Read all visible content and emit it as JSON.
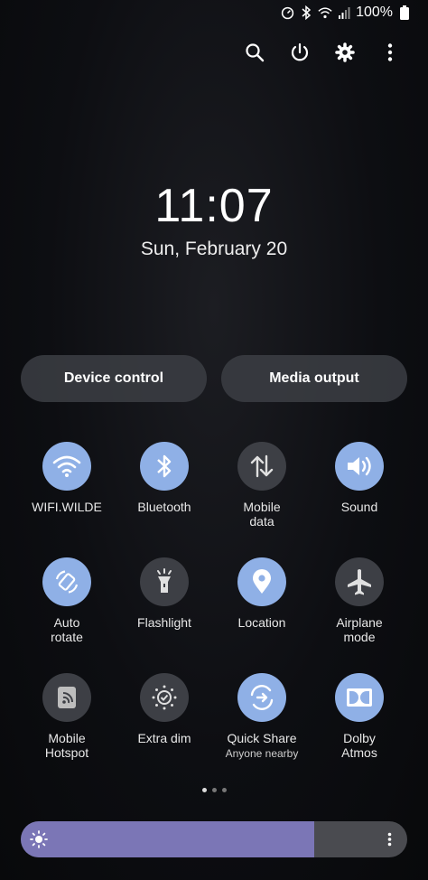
{
  "status_bar": {
    "battery": "100%",
    "icons": [
      "data-saver-icon",
      "bluetooth-icon",
      "wifi-icon",
      "signal-icon",
      "battery-icon"
    ]
  },
  "top_actions": [
    "search-icon",
    "power-icon",
    "settings-icon",
    "more-icon"
  ],
  "clock": {
    "time": "11:07",
    "date": "Sun, February 20"
  },
  "pills": {
    "device_control": "Device control",
    "media_output": "Media output"
  },
  "tiles": [
    {
      "label": "WIFI.WILDE",
      "icon": "wifi-icon",
      "on": true
    },
    {
      "label": "Bluetooth",
      "icon": "bluetooth-icon",
      "on": true
    },
    {
      "label": "Mobile\ndata",
      "icon": "mobile-data-icon",
      "on": false
    },
    {
      "label": "Sound",
      "icon": "sound-icon",
      "on": true
    },
    {
      "label": "Auto\nrotate",
      "icon": "auto-rotate-icon",
      "on": true
    },
    {
      "label": "Flashlight",
      "icon": "flashlight-icon",
      "on": false
    },
    {
      "label": "Location",
      "icon": "location-icon",
      "on": true
    },
    {
      "label": "Airplane\nmode",
      "icon": "airplane-icon",
      "on": false
    },
    {
      "label": "Mobile\nHotspot",
      "icon": "hotspot-icon",
      "on": false
    },
    {
      "label": "Extra dim",
      "icon": "extra-dim-icon",
      "on": false
    },
    {
      "label": "Quick Share",
      "sub": "Anyone nearby",
      "icon": "quick-share-icon",
      "on": true
    },
    {
      "label": "Dolby\nAtmos",
      "icon": "dolby-icon",
      "on": true
    }
  ],
  "page_indicator": {
    "pages": 3,
    "current": 1
  },
  "brightness": {
    "level_percent": 76
  },
  "colors": {
    "tile_on": "#8fb0e6",
    "tile_off": "#3d3f45",
    "brightness_fill": "#7b76b6"
  }
}
